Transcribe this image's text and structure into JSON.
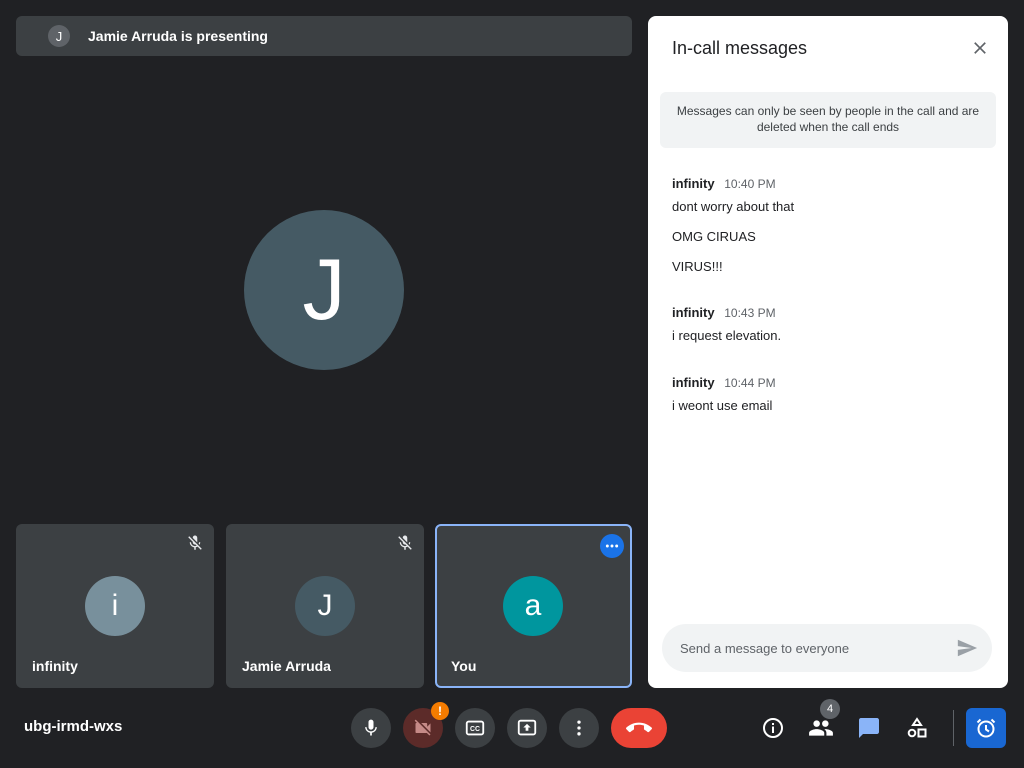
{
  "banner": {
    "avatar_initial": "J",
    "text": "Jamie Arruda is presenting"
  },
  "main_stage": {
    "avatar_initial": "J",
    "avatar_color": "#455a64"
  },
  "tiles": [
    {
      "name": "infinity",
      "initial": "i",
      "avatar_color": "#78909c",
      "muted": true
    },
    {
      "name": "Jamie Arruda",
      "initial": "J",
      "avatar_color": "#455a64",
      "muted": true
    },
    {
      "name": "You",
      "initial": "a",
      "avatar_color": "#00969e",
      "selected": true
    }
  ],
  "chat_panel": {
    "title": "In-call messages",
    "notice": "Messages can only be seen by people in the call and are deleted when the call ends",
    "groups": [
      {
        "sender": "infinity",
        "time": "10:40 PM",
        "messages": [
          "dont worry about that",
          "OMG CIRUAS",
          "VIRUS!!!"
        ]
      },
      {
        "sender": "infinity",
        "time": "10:43 PM",
        "messages": [
          "i request elevation."
        ]
      },
      {
        "sender": "infinity",
        "time": "10:44 PM",
        "messages": [
          "i weont use email"
        ]
      }
    ],
    "compose_placeholder": "Send a message to everyone"
  },
  "bottom_bar": {
    "meeting_code": "ubg-irmd-wxs",
    "camera_warning": "!",
    "participants_count": "4"
  },
  "icons": {
    "mic": "microphone-icon",
    "camera": "camera-off-icon",
    "captions": "captions-icon",
    "present": "present-screen-icon",
    "more": "more-vert-icon",
    "end_call": "phone-hangup-icon",
    "info": "info-icon",
    "people": "people-icon",
    "chat": "chat-icon",
    "activities": "activities-icon",
    "timer": "alarm-icon"
  },
  "colors": {
    "background": "#202124",
    "accent": "#8ab4f8",
    "end_call": "#ea4335",
    "warning": "#f57c00"
  }
}
